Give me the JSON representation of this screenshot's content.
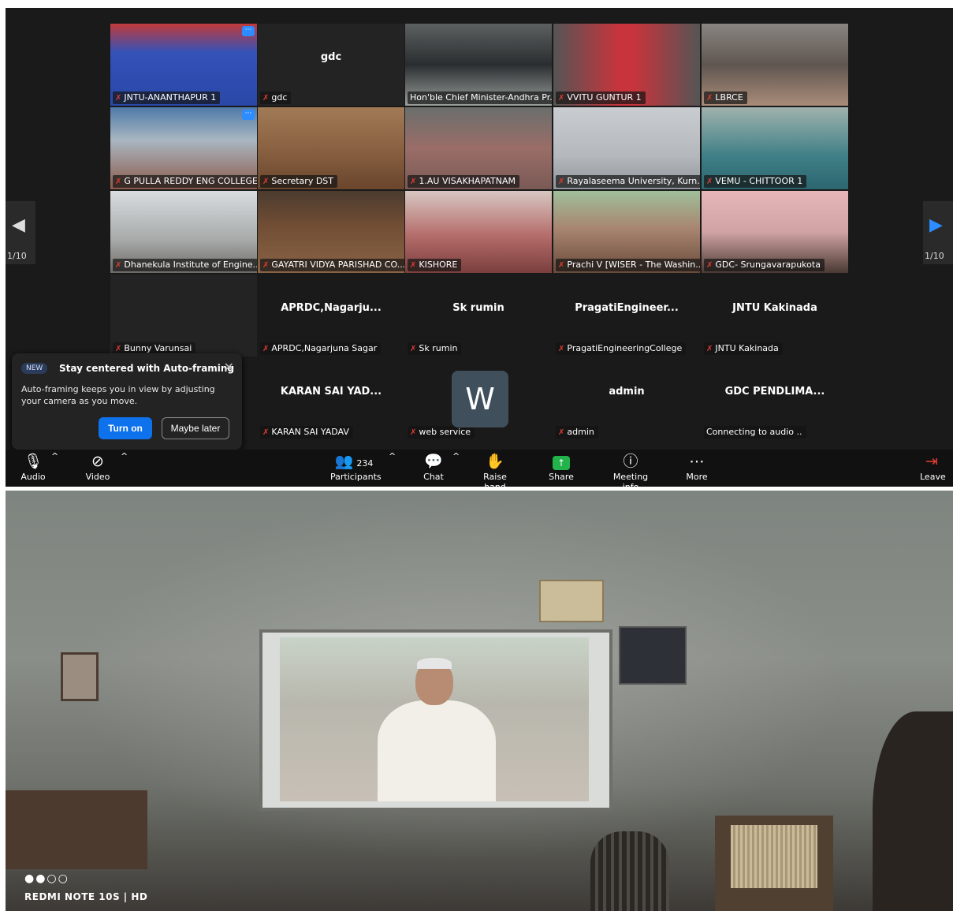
{
  "tiles": [
    {
      "name": "JNTU-ANANTHAPUR 1"
    },
    {
      "name": "gdc",
      "center": "gdc"
    },
    {
      "name": "Hon'ble Chief Minister-Andhra Pr..."
    },
    {
      "name": "VVITU GUNTUR 1"
    },
    {
      "name": "LBRCE"
    },
    {
      "name": "G PULLA REDDY ENG COLLEGE"
    },
    {
      "name": "Secretary DST"
    },
    {
      "name": "1.AU VISAKHAPATNAM"
    },
    {
      "name": "Rayalaseema University, Kurn..."
    },
    {
      "name": "VEMU - CHITTOOR 1"
    },
    {
      "name": "Dhanekula Institute of Engine..."
    },
    {
      "name": "GAYATRI VIDYA PARISHAD CO..."
    },
    {
      "name": "KISHORE"
    },
    {
      "name": "Prachi V [WISER - The Washin..."
    },
    {
      "name": "GDC- Srungavarapukota"
    },
    {
      "name": "Bunny Varunsai"
    },
    {
      "name": "APRDC,Nagarjuna Sagar",
      "center": "APRDC,Nagarju..."
    },
    {
      "name": "Sk rumin",
      "center": "Sk rumin"
    },
    {
      "name": "PragatiEngineeringCollege",
      "center": "PragatiEngineer..."
    },
    {
      "name": "JNTU Kakinada",
      "center": "JNTU Kakinada"
    },
    {
      "name": "KARAN SAI YADAV",
      "center": "KARAN SAI YAD..."
    },
    {
      "name": "web service",
      "avatar": "W"
    },
    {
      "name": "admin",
      "center": "admin"
    },
    {
      "name": "Connecting to audio ..",
      "center": "GDC PENDLIMA..."
    }
  ],
  "pagination": {
    "left": "1/10",
    "right": "1/10"
  },
  "popup": {
    "badge": "NEW",
    "title": "Stay centered with Auto-framing",
    "body": "Auto-framing keeps you in view by adjusting your camera as you move.",
    "turn_on": "Turn on",
    "maybe_later": "Maybe later"
  },
  "toolbar": {
    "audio": "Audio",
    "video": "Video",
    "participants": "Participants",
    "participant_count": "234",
    "chat": "Chat",
    "raise_hand": "Raise hand",
    "share": "Share",
    "meeting_info": "Meeting info",
    "more": "More",
    "leave": "Leave"
  },
  "photo": {
    "camera_watermark": "REDMI NOTE 10S | HD"
  },
  "colors": {
    "accent": "#0e72ed",
    "active_speaker": "#3dc26b",
    "muted": "#e03c31",
    "share": "#22b34a"
  }
}
